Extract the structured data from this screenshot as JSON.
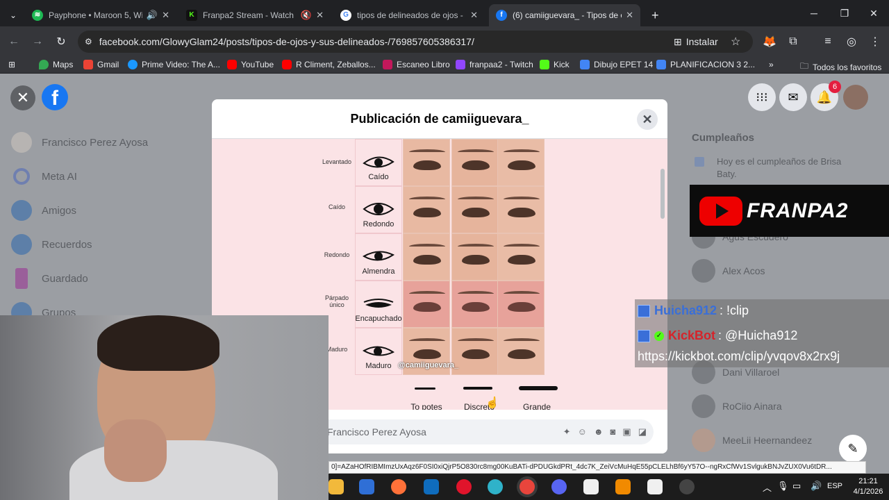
{
  "browser": {
    "tabs": [
      {
        "title": "Payphone • Maroon 5, Wiz",
        "icon_color": "#1db954",
        "icon": "spotify-icon",
        "audio": "speaker-icon"
      },
      {
        "title": "Franpa2 Stream - Watch Liv",
        "icon_color": "#53fc18",
        "icon": "kick-icon",
        "audio": "muted-speaker-icon"
      },
      {
        "title": "tipos de delineados de ojos - Bi",
        "icon_color": "#4285f4",
        "icon": "google-icon"
      },
      {
        "title": "(6) camiiguevara_ - Tipos de oj",
        "icon_color": "#1877f2",
        "icon": "facebook-icon"
      }
    ],
    "url": "facebook.com/GlowyGlam24/posts/tipos-de-ojos-y-sus-delineados-/769857605386317/",
    "install_label": "Instalar",
    "bookmarks": [
      {
        "label": "Maps",
        "color": "#34a853"
      },
      {
        "label": "Gmail",
        "color": "#ea4335"
      },
      {
        "label": "Prime Video: The A...",
        "color": "#1a98ff"
      },
      {
        "label": "YouTube",
        "color": "#ff0000"
      },
      {
        "label": "R Climent, Zeballos...",
        "color": "#ff0000"
      },
      {
        "label": "Escaneo Libro",
        "color": "#c2185b"
      },
      {
        "label": "franpaa2 - Twitch",
        "color": "#9146ff"
      },
      {
        "label": "Kick",
        "color": "#53fc18"
      },
      {
        "label": "Dibujo EPET 14",
        "color": "#4285f4"
      },
      {
        "label": "PLANIFICACION 3 2...",
        "color": "#4285f4"
      }
    ],
    "all_bookmarks_label": "Todos los favoritos"
  },
  "facebook": {
    "sidebar": [
      {
        "label": "Francisco Perez Ayosa",
        "icon": "avatar"
      },
      {
        "label": "Meta AI",
        "icon": "meta-ai-icon"
      },
      {
        "label": "Amigos",
        "icon": "friends-icon"
      },
      {
        "label": "Recuerdos",
        "icon": "memories-icon"
      },
      {
        "label": "Guardado",
        "icon": "saved-icon"
      },
      {
        "label": "Grupos",
        "icon": "groups-icon"
      }
    ],
    "notification_count": "6",
    "right": {
      "birthdays_title": "Cumpleaños",
      "birthday_text": "Hoy es el cumpleaños de Brisa Baty.",
      "contacts": [
        "Agus Escudero",
        "Alex Acos",
        "Dani Villaroel",
        "RoCiio Ainara",
        "MeeLii Heernandeez"
      ]
    }
  },
  "modal": {
    "title": "Publicación de camiiguevara_",
    "rows": [
      {
        "left": "Levantado",
        "eye": "Caído"
      },
      {
        "left": "Caído",
        "eye": "Redondo"
      },
      {
        "left": "Redondo",
        "eye": "Almendra"
      },
      {
        "left": "Párpado único",
        "eye": "Encapuchado"
      },
      {
        "left": "Maduro",
        "eye": "Maduro"
      }
    ],
    "watermark": "@camiiguevara_",
    "liner_styles": [
      "To potes",
      "Discreto",
      "Grande"
    ],
    "comment_placeholder": "Francisco Perez Ayosa"
  },
  "overlay": {
    "logo_text": "FRANPA2",
    "chat": [
      {
        "user": "Huicha912",
        "message": ": !clip",
        "user_color": "#3a6fd8"
      },
      {
        "user": "KickBot",
        "message": ": @Huicha912",
        "user_color": "#d6232a"
      }
    ],
    "chat_link": "https://kickbot.com/clip/yvqov8x2rx9j"
  },
  "status_url": "0]=AZaHOfRIBMImzUxAqz6F0SI0xiQjrP5O830rc8mg00KuBATi-dPDUGkdPRt_4dc7K_ZeiVcMuHqE55pCLELhBf6yY57O--ngRxCfWv1SvlgukBNJvZUX0Vu6tDR...",
  "taskbar": {
    "language": "ESP",
    "time": "21:21",
    "date": "4/1/2026"
  }
}
